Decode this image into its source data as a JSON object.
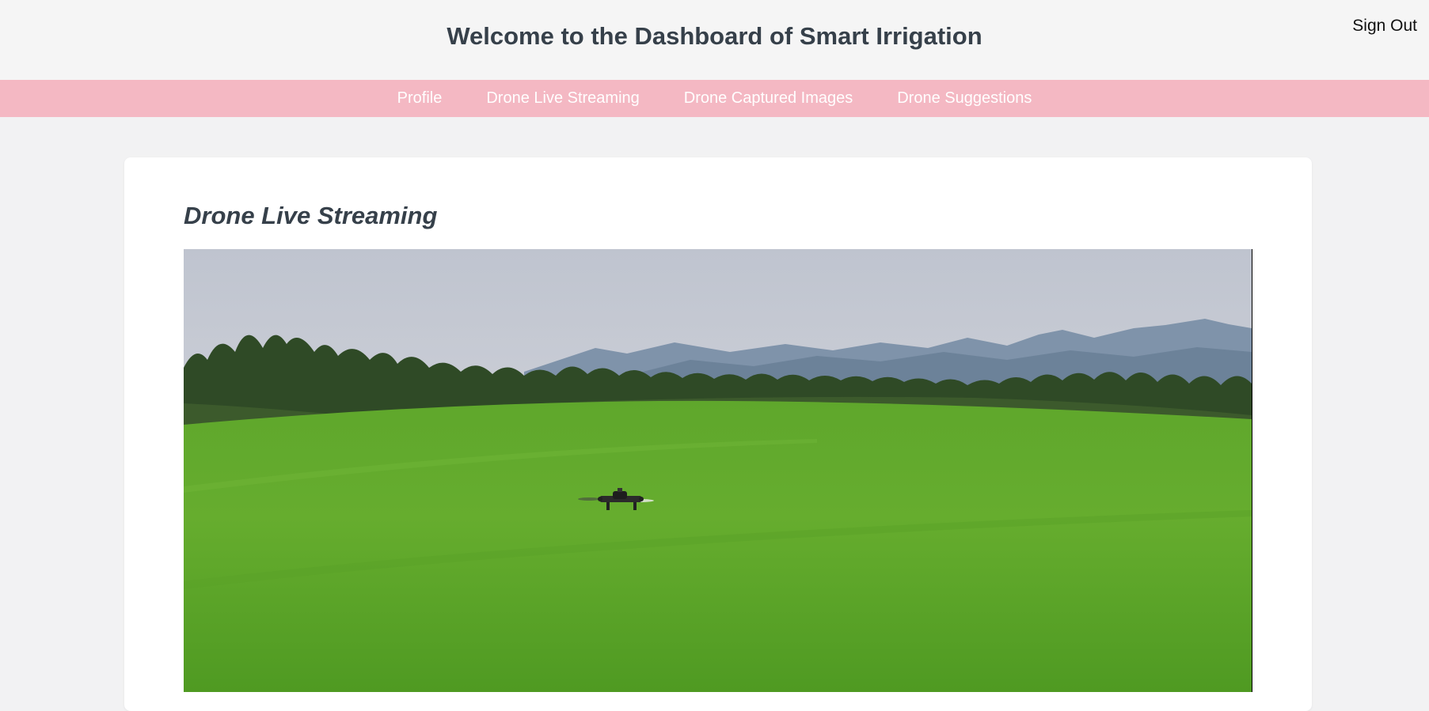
{
  "header": {
    "title": "Welcome to the Dashboard of Smart Irrigation",
    "sign_out": "Sign Out"
  },
  "nav": {
    "items": [
      {
        "label": "Profile"
      },
      {
        "label": "Drone Live Streaming"
      },
      {
        "label": "Drone Captured Images"
      },
      {
        "label": "Drone Suggestions"
      }
    ]
  },
  "main": {
    "section_title": "Drone Live Streaming",
    "video": {
      "scene": "drone-over-green-field-icon"
    }
  },
  "colors": {
    "header_bg": "#f5f5f5",
    "nav_bg": "#f4b8c3",
    "nav_text": "#ffffff",
    "title_text": "#36404a",
    "page_bg": "#f2f2f3",
    "card_bg": "#ffffff"
  }
}
